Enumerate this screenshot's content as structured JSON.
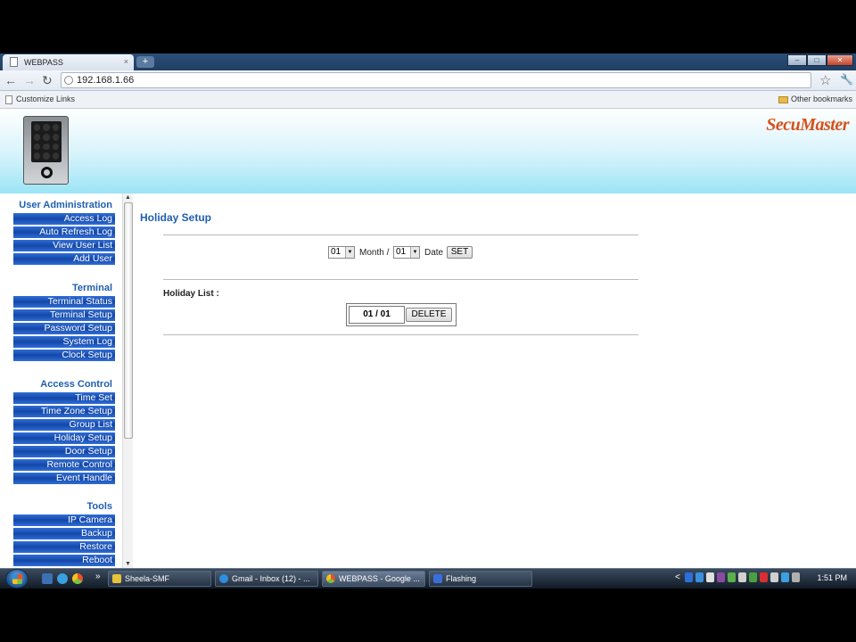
{
  "browser": {
    "tab_title": "WEBPASS",
    "tab_close": "×",
    "new_tab": "+",
    "url": "192.168.1.66",
    "bookmark_left": "Customize Links",
    "bookmark_right": "Other bookmarks",
    "icons": [
      "back-icon",
      "forward-icon",
      "reload-icon",
      "star-icon",
      "wrench-icon"
    ]
  },
  "header": {
    "brand": "SecuMaster"
  },
  "sidebar": {
    "sections": [
      {
        "title": "User Administration",
        "items": [
          "Access Log",
          "Auto Refresh Log",
          "View User List",
          "Add User"
        ]
      },
      {
        "title": "Terminal",
        "items": [
          "Terminal Status",
          "Terminal Setup",
          "Password Setup",
          "System Log",
          "Clock Setup"
        ]
      },
      {
        "title": "Access Control",
        "items": [
          "Time Set",
          "Time Zone Setup",
          "Group List",
          "Holiday Setup",
          "Door Setup",
          "Remote Control",
          "Event Handle"
        ]
      },
      {
        "title": "Tools",
        "items": [
          "IP Camera",
          "Backup",
          "Restore",
          "Reboot"
        ]
      }
    ]
  },
  "main": {
    "title": "Holiday Setup",
    "month_value": "01",
    "month_label": "Month /",
    "date_value": "01",
    "date_label": "Date",
    "set_button": "SET",
    "holiday_list_label": "Holiday List  :",
    "holiday_entries": [
      {
        "date": "01 / 01",
        "delete_label": "DELETE"
      }
    ]
  },
  "taskbar": {
    "tasks": [
      {
        "label": "Sheela-SMF",
        "icon_color": "#e8c23a",
        "active": false
      },
      {
        "label": "Gmail - Inbox (12) - ...",
        "icon_color": "#2c8fe0",
        "active": false
      },
      {
        "label": "WEBPASS - Google ...",
        "icon_color": "#d84a2a",
        "active": true
      },
      {
        "label": "Flashing",
        "icon_color": "#3b6fd8",
        "active": false
      }
    ],
    "clock": "1:51 PM",
    "chevron": "»",
    "tray_chevron": "<"
  }
}
